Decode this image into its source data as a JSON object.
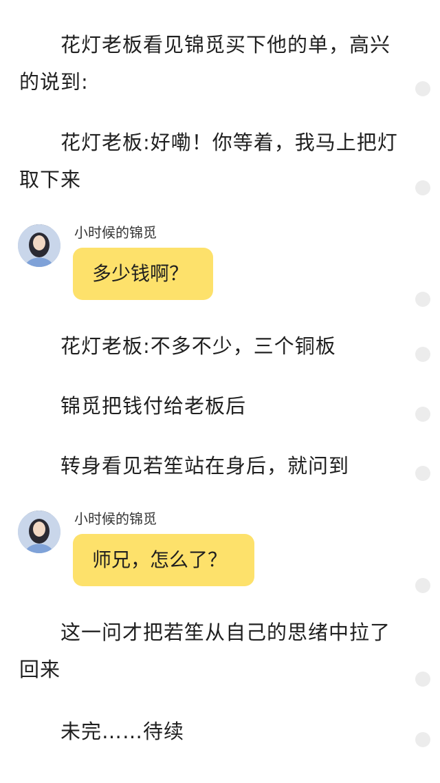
{
  "paragraphs": [
    "花灯老板看见锦觅买下他的单，高兴的说到:",
    "花灯老板:好嘞！你等着，我马上把灯取下来",
    "花灯老板:不多不少，三个铜板",
    "锦觅把钱付给老板后",
    "转身看见若笙站在身后，就问到",
    "这一问才把若笙从自己的思绪中拉了回来",
    "未完……待续"
  ],
  "dialogs": [
    {
      "speaker": "小时候的锦觅",
      "text": "多少钱啊？"
    },
    {
      "speaker": "小时候的锦觅",
      "text": "师兄，怎么了？"
    }
  ],
  "colors": {
    "bubble": "#fde16b",
    "dot": "#ececec",
    "text": "#1f1f1f"
  },
  "icons": {
    "avatar": "avatar-icon",
    "comment_dot": "comment-dot-icon"
  }
}
